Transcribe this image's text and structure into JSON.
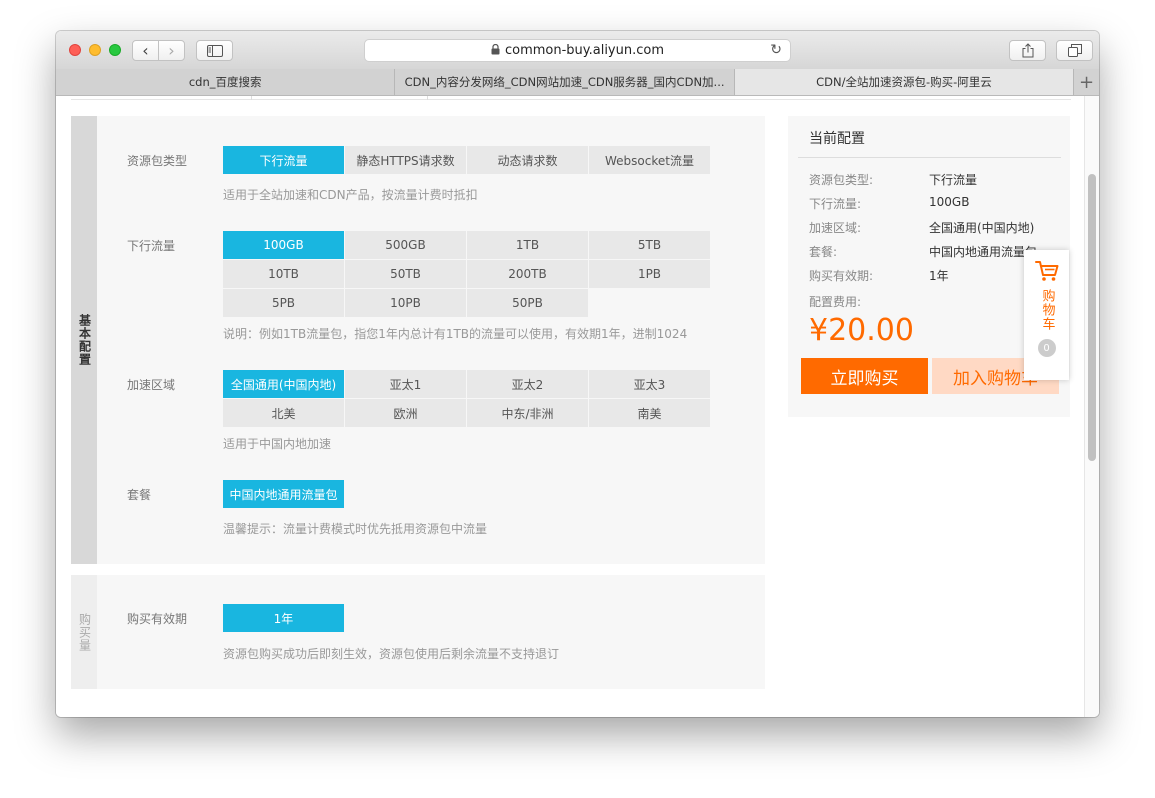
{
  "browser": {
    "url": "common-buy.aliyun.com",
    "tabs": [
      {
        "title": "cdn_百度搜索"
      },
      {
        "title": "CDN_内容分发网络_CDN网站加速_CDN服务器_国内CDN加..."
      },
      {
        "title": "CDN/全站加速资源包-购买-阿里云"
      }
    ]
  },
  "sections": {
    "basic": {
      "label": "基本配置"
    },
    "quantity": {
      "label": "购买量"
    }
  },
  "config": {
    "package_type": {
      "label": "资源包类型",
      "options": [
        "下行流量",
        "静态HTTPS请求数",
        "动态请求数",
        "Websocket流量"
      ],
      "hint": "适用于全站加速和CDN产品，按流量计费时抵扣"
    },
    "traffic": {
      "label": "下行流量",
      "options": [
        "100GB",
        "500GB",
        "1TB",
        "5TB",
        "10TB",
        "50TB",
        "200TB",
        "1PB",
        "5PB",
        "10PB",
        "50PB"
      ],
      "hint": "说明：例如1TB流量包，指您1年内总计有1TB的流量可以使用，有效期1年，进制1024"
    },
    "region": {
      "label": "加速区域",
      "options": [
        "全国通用(中国内地)",
        "亚太1",
        "亚太2",
        "亚太3",
        "北美",
        "欧洲",
        "中东/非洲",
        "南美"
      ],
      "hint": "适用于中国内地加速"
    },
    "plan": {
      "label": "套餐",
      "options": [
        "中国内地通用流量包"
      ],
      "hint": "温馨提示：流量计费模式时优先抵用资源包中流量"
    },
    "validity": {
      "label": "购买有效期",
      "options": [
        "1年"
      ],
      "hint": "资源包购买成功后即刻生效，资源包使用后剩余流量不支持退订"
    }
  },
  "summary": {
    "title": "当前配置",
    "items": [
      {
        "key": "资源包类型:",
        "value": "下行流量"
      },
      {
        "key": "下行流量:",
        "value": "100GB"
      },
      {
        "key": "加速区域:",
        "value": "全国通用(中国内地)"
      },
      {
        "key": "套餐:",
        "value": "中国内地通用流量包"
      },
      {
        "key": "购买有效期:",
        "value": "1年"
      }
    ],
    "fee_label": "配置费用:",
    "price": "¥20.00",
    "buy_label": "立即购买",
    "add_cart_label": "加入购物车"
  },
  "float_cart": {
    "label": "购物车",
    "count": "0"
  },
  "colors": {
    "selected": "#19b6e0",
    "accent": "#ff6a00"
  }
}
